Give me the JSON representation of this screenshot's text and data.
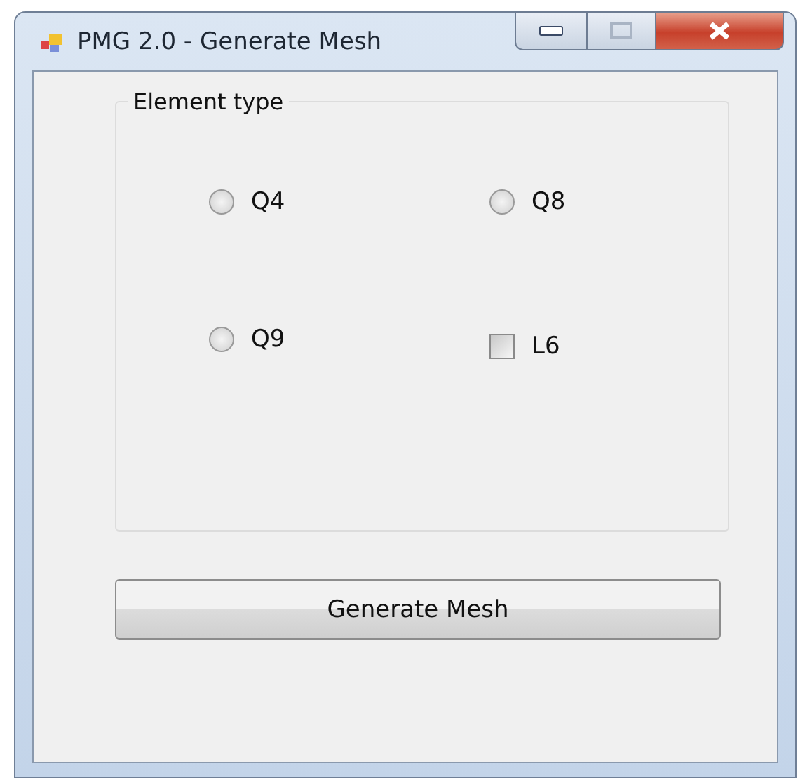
{
  "window": {
    "title": "PMG 2.0 - Generate Mesh"
  },
  "group": {
    "legend": "Element type",
    "options": [
      {
        "kind": "radio",
        "label": "Q4",
        "selected": false
      },
      {
        "kind": "radio",
        "label": "Q8",
        "selected": false
      },
      {
        "kind": "radio",
        "label": "Q9",
        "selected": false
      },
      {
        "kind": "checkbox",
        "label": "L6",
        "checked": false
      }
    ]
  },
  "buttons": [
    "Generate Mesh"
  ]
}
